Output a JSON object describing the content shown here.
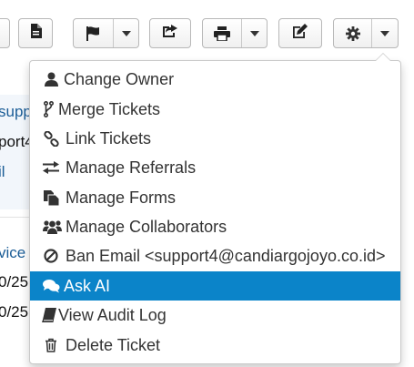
{
  "toolbar": {
    "buttons": [
      {
        "name": "toolbar-edge-button"
      },
      {
        "name": "export-pdf-button",
        "icon": "file-icon"
      },
      {
        "name": "flag-button",
        "icon": "flag-icon"
      },
      {
        "name": "share-button",
        "icon": "share-icon"
      },
      {
        "name": "print-button",
        "icon": "print-icon"
      },
      {
        "name": "edit-button",
        "icon": "edit-icon"
      },
      {
        "name": "settings-button",
        "icon": "gear-icon"
      }
    ]
  },
  "background": {
    "fragments": [
      "suppo",
      "port4",
      "il",
      "vice",
      "0/25",
      "0/25"
    ]
  },
  "menu": {
    "active_color": "#0b84c9",
    "items": [
      {
        "label": "Change Owner",
        "icon": "user-icon"
      },
      {
        "label": "Merge Tickets",
        "icon": "code-fork-icon"
      },
      {
        "label": "Link Tickets",
        "icon": "link-icon"
      },
      {
        "label": "Manage Referrals",
        "icon": "exchange-icon"
      },
      {
        "label": "Manage Forms",
        "icon": "copy-icon"
      },
      {
        "label": "Manage Collaborators",
        "icon": "group-icon"
      },
      {
        "label": "Ban Email <support4@candiargojoyo.co.id>",
        "icon": "ban-icon"
      },
      {
        "label": "Ask AI",
        "icon": "comments-icon",
        "active": true
      },
      {
        "label": "View Audit Log",
        "icon": "book-icon"
      },
      {
        "label": "Delete Ticket",
        "icon": "trash-icon"
      }
    ]
  }
}
